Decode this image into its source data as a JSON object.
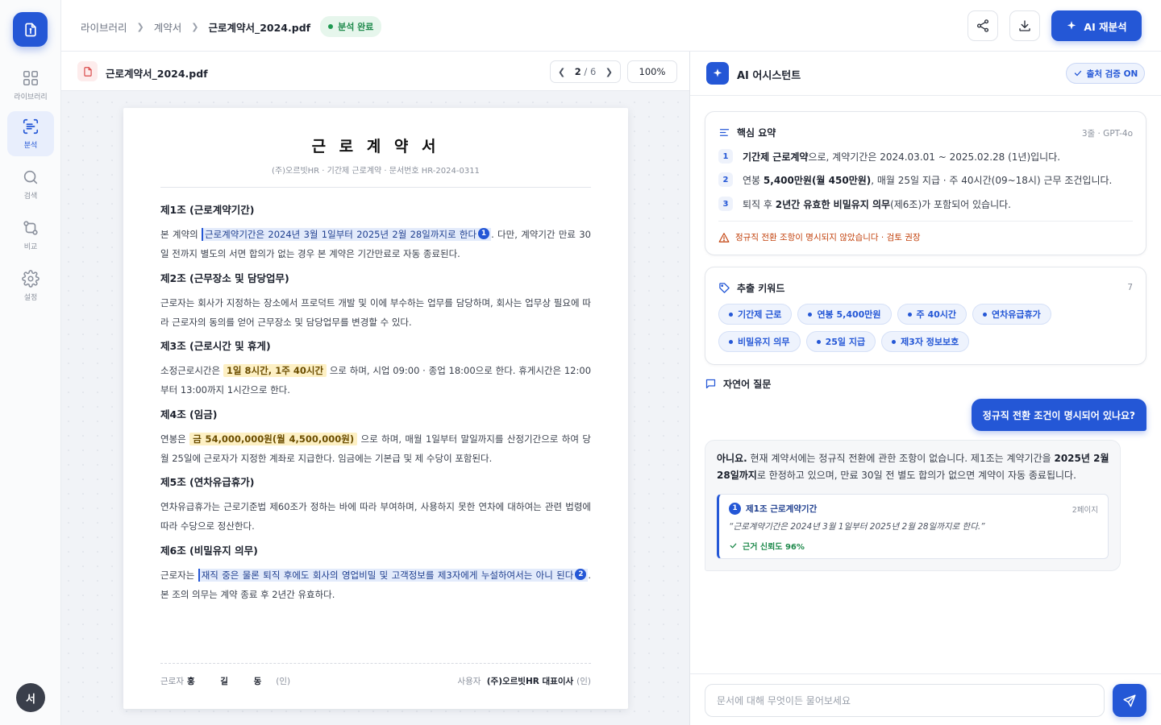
{
  "rail": {
    "items": [
      {
        "label": "라이브러리",
        "icon": "grid-icon"
      },
      {
        "label": "분석",
        "icon": "scan-text-icon"
      },
      {
        "label": "검색",
        "icon": "search-icon"
      },
      {
        "label": "비교",
        "icon": "compare-icon"
      },
      {
        "label": "설정",
        "icon": "gear-icon"
      }
    ],
    "active": "분석",
    "avatar": "서"
  },
  "topbar": {
    "breadcrumb": [
      "라이브러리",
      "계약서",
      "근로계약서_2024.pdf"
    ],
    "status_badge": "분석 완료",
    "reanalyze_label": "AI 재분석"
  },
  "viewer": {
    "filename": "근로계약서_2024.pdf",
    "page_current": "2",
    "page_total": "6",
    "zoom": "100%"
  },
  "document": {
    "title": "근 로 계 약 서",
    "meta": "(주)오르빗HR  ·  기간제 근로계약  ·  문서번호 HR-2024-0311",
    "articles": [
      {
        "heading": "제1조 (근로계약기간)",
        "pre": "본 계약의 ",
        "highlight": "근로계약기간은 2024년 3월 1일부터 2025년 2월 28일까지로 한다",
        "cite": "1",
        "post": ". 다만, 계약기간 만료 30일 전까지 별도의 서면 합의가 없는 경우 본 계약은 기간만료로 자동 종료된다."
      },
      {
        "heading": "제2조 (근무장소 및 담당업무)",
        "text": "근로자는 회사가 지정하는 장소에서 프로덕트 개발 및 이에 부수하는 업무를 담당하며, 회사는 업무상 필요에 따라 근로자의 동의를 얻어 근무장소 및 담당업무를 변경할 수 있다."
      },
      {
        "heading": "제3조 (근로시간 및 휴게)",
        "pre": "소정근로시간은 ",
        "highlight": "1일 8시간, 1주 40시간",
        "post": " 으로 하며, 시업 09:00 · 종업 18:00으로 한다. 휴게시간은 12:00부터 13:00까지 1시간으로 한다."
      },
      {
        "heading": "제4조 (임금)",
        "pre": "연봉은 ",
        "highlight": "금 54,000,000원(월 4,500,000원)",
        "post": " 으로 하며, 매월 1일부터 말일까지를 산정기간으로 하여 당월 25일에 근로자가 지정한 계좌로 지급한다. 임금에는 기본급 및 제 수당이 포함된다."
      },
      {
        "heading": "제5조 (연차유급휴가)",
        "text": "연차유급휴가는 근로기준법 제60조가 정하는 바에 따라 부여하며, 사용하지 못한 연차에 대하여는 관련 법령에 따라 수당으로 정산한다."
      },
      {
        "heading": "제6조 (비밀유지 의무)",
        "pre": "근로자는 ",
        "highlight": "재직 중은 물론 퇴직 후에도 회사의 영업비밀 및 고객정보를 제3자에게 누설하여서는 아니 된다",
        "cite": "2",
        "post": ". 본 조의 의무는 계약 종료 후 2년간 유효하다."
      }
    ],
    "sign": {
      "worker_label": "근로자",
      "worker_name": "홍 길 동",
      "employer_label": "사용자",
      "employer_name": "(주)오르빗HR 대표이사",
      "seal": "(인)"
    }
  },
  "assistant": {
    "title": "AI 어시스턴트",
    "verify_badge": "출처 검증 ON",
    "summary": {
      "title": "핵심 요약",
      "meta": "3줄 · GPT-4o",
      "items": [
        {
          "num": "1",
          "bold": "기간제 근로계약",
          "rest": "으로, 계약기간은 2024.03.01 ~ 2025.02.28 (1년)입니다."
        },
        {
          "num": "2",
          "pre": "연봉 ",
          "bold": "5,400만원(월 450만원)",
          "rest": ", 매월 25일 지급 · 주 40시간(09~18시) 근무 조건입니다."
        },
        {
          "num": "3",
          "pre": "퇴직 후 ",
          "bold": "2년간 유효한 비밀유지 의무",
          "rest": "(제6조)가 포함되어 있습니다."
        }
      ],
      "warning": "정규직 전환 조항이 명시되지 않았습니다 · 검토 권장"
    },
    "keywords": {
      "title": "추출 키워드",
      "count": "7",
      "items": [
        "기간제 근로",
        "연봉 5,400만원",
        "주 40시간",
        "연차유급휴가",
        "비밀유지 의무",
        "25일 지급",
        "제3자 정보보호"
      ]
    },
    "chat": {
      "title": "자연어 질문",
      "question": "정규직 전환 조건이 명시되어 있나요?",
      "answer_bold1": "아니요.",
      "answer_part1": " 현재 계약서에는 정규직 전환에 관한 조항이 없습니다. 제1조는 계약기간을 ",
      "answer_bold2": "2025년 2월 28일까지",
      "answer_part2": "로 한정하고 있으며, 만료 30일 전 별도 합의가 없으면 계약이 자동 종료됩니다.",
      "source": {
        "num": "1",
        "title": "제1조 근로계약기간",
        "page": "2페이지",
        "quote": "“근로계약기간은 2024년 3월 1일부터 2025년 2월 28일까지로 한다.”",
        "confidence": "근거 신뢰도 96%"
      }
    },
    "input": {
      "placeholder": "문서에 대해 무엇이든 물어보세요"
    }
  },
  "colors": {
    "accent": "#2457d6",
    "success": "#1f8a4c",
    "warning": "#c2410c",
    "highlight_yellow": "#fdf0c4"
  }
}
